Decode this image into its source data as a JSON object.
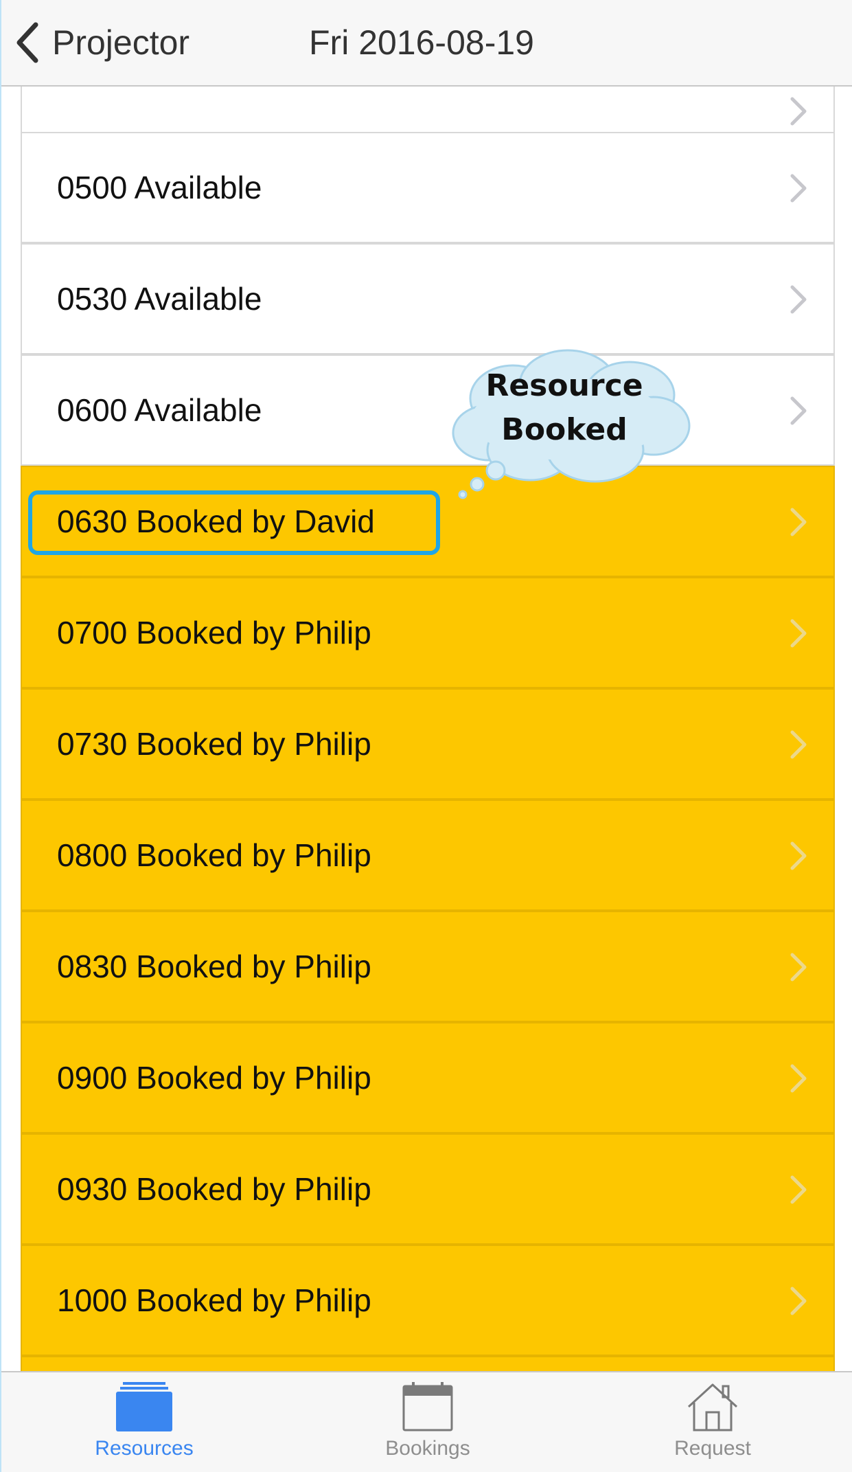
{
  "navbar": {
    "back_label": "Projector",
    "title": "Fri 2016-08-19"
  },
  "slots": [
    {
      "label": "",
      "status": "available"
    },
    {
      "label": "0500 Available",
      "status": "available"
    },
    {
      "label": "0530 Available",
      "status": "available"
    },
    {
      "label": "0600 Available",
      "status": "available"
    },
    {
      "label": "0630 Booked by David",
      "status": "booked",
      "highlighted": true
    },
    {
      "label": "0700 Booked by Philip",
      "status": "booked"
    },
    {
      "label": "0730 Booked by Philip",
      "status": "booked"
    },
    {
      "label": "0800 Booked by Philip",
      "status": "booked"
    },
    {
      "label": "0830 Booked by Philip",
      "status": "booked"
    },
    {
      "label": "0900 Booked by Philip",
      "status": "booked"
    },
    {
      "label": "0930 Booked by Philip",
      "status": "booked"
    },
    {
      "label": "1000 Booked by Philip",
      "status": "booked"
    },
    {
      "label": "",
      "status": "booked"
    }
  ],
  "callout": {
    "line1": "Resource",
    "line2": "Booked"
  },
  "tabbar": {
    "tabs": [
      {
        "label": "Resources",
        "icon": "resources-icon",
        "active": true
      },
      {
        "label": "Bookings",
        "icon": "calendar-icon",
        "active": false
      },
      {
        "label": "Request",
        "icon": "house-icon",
        "active": false
      }
    ]
  },
  "colors": {
    "booked": "#fdc700",
    "available": "#ffffff",
    "accent": "#3a86f0",
    "highlight": "#1fa6e6",
    "callout_fill": "#d6ecf6"
  }
}
